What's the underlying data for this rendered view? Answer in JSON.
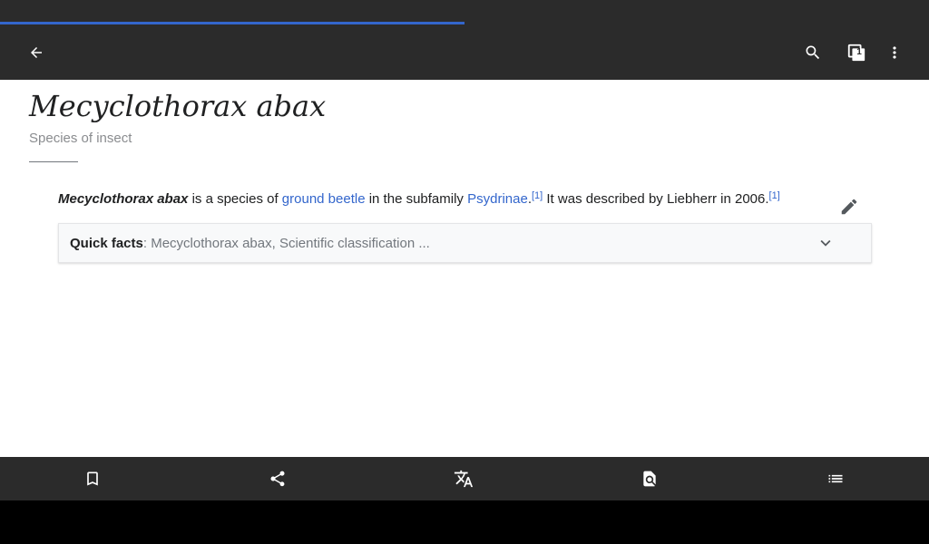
{
  "colors": {
    "toolbar_bg": "#2b2b2b",
    "accent": "#3366cc",
    "text": "#202122",
    "subtle_text": "#8a8c8f"
  },
  "progress": {
    "fraction": 0.5
  },
  "toolbar": {
    "back_icon": "arrow-back-icon",
    "search_icon": "search-icon",
    "tabs_icon": "tabs-icon",
    "tab_count": "1",
    "menu_icon": "more-vertical-icon"
  },
  "article": {
    "title": "Mecyclothorax abax",
    "subtitle": "Species of insect",
    "paragraph": {
      "bold_name": "Mecyclothorax abax",
      "text1": " is a species of ",
      "link1": "ground beetle",
      "text2": " in the subfamily ",
      "link2": "Psydrinae",
      "text3": ".",
      "ref1": "[1]",
      "text4": " It was described by Liebherr in 2006.",
      "ref2": "[1]"
    },
    "edit_icon": "pencil-icon",
    "quick_facts": {
      "label": "Quick facts",
      "summary": ": Mecyclothorax abax, Scientific classification ...",
      "chevron_icon": "chevron-down-icon"
    }
  },
  "bottom_bar": {
    "items": [
      {
        "name": "save",
        "icon": "bookmark-icon"
      },
      {
        "name": "share",
        "icon": "share-icon"
      },
      {
        "name": "language",
        "icon": "translate-icon"
      },
      {
        "name": "find-in-page",
        "icon": "find-in-page-icon"
      },
      {
        "name": "contents",
        "icon": "list-icon"
      }
    ]
  }
}
